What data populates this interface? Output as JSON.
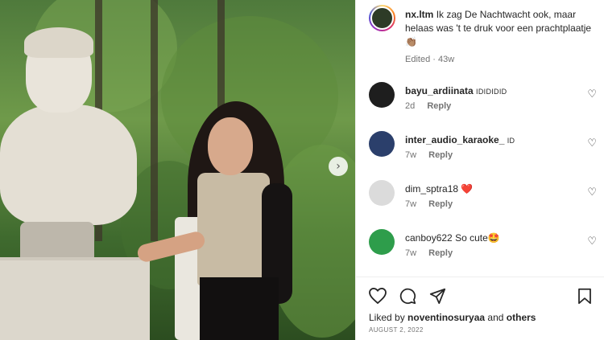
{
  "post": {
    "username": "nx.ltm",
    "caption": "Ik zag De Nachtwacht ook, maar helaas was 't te druk voor een prachtplaatje 👏🏽",
    "edited_label": "Edited",
    "edited_time": "43w"
  },
  "comments": [
    {
      "username": "bayu_ardiinata",
      "text": "IDIDIDID",
      "time": "2d",
      "reply": "Reply",
      "avatar_color": "#1e1e1e"
    },
    {
      "username": "inter_audio_karaoke_",
      "text": "ID",
      "time": "7w",
      "reply": "Reply",
      "avatar_color": "#2b3f6b"
    },
    {
      "username": "dim_sptra18",
      "text": "❤️",
      "time": "7w",
      "reply": "Reply",
      "avatar_color": "#dbdbdb"
    },
    {
      "username": "canboy622",
      "text": "So cute🤩",
      "time": "7w",
      "reply": "Reply",
      "avatar_color": "#2e9d4b"
    }
  ],
  "actions": {
    "like_icon": "heart-outline-icon",
    "comment_icon": "comment-bubble-icon",
    "share_icon": "paper-plane-icon",
    "save_icon": "bookmark-icon"
  },
  "likes": {
    "prefix": "Liked by",
    "user": "noventinosuryaa",
    "connector": "and",
    "others": "others"
  },
  "date": "AUGUST 2, 2022",
  "photo": {
    "next_icon": "chevron-right-icon"
  }
}
